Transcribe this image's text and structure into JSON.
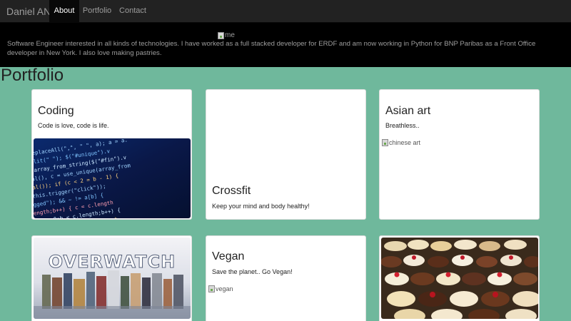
{
  "navbar": {
    "brand": "Daniel AN",
    "links": [
      {
        "label": "About",
        "active": true
      },
      {
        "label": "Portfolio",
        "active": false
      },
      {
        "label": "Contact",
        "active": false
      }
    ]
  },
  "header": {
    "avatar_alt": "me",
    "bio": "Software Engineer interested in all kinds of technologies. I have worked as a full stacked developer for ERDF and am now working in Python for BNP Paribas as a Front Office developer in New York. I also love making pastries."
  },
  "portfolio": {
    "title": "Portfolio",
    "cards": [
      {
        "title": "Coding",
        "text": "Code is love, code is life.",
        "image": "code-screenshot"
      },
      {
        "title": "Crossfit",
        "text": "Keep your mind and body healthy!",
        "image": ""
      },
      {
        "title": "Asian art",
        "text": "Breathless..",
        "image_alt": "chinese art"
      },
      {
        "title": "",
        "text": "",
        "image": "overwatch-banner",
        "image_text": "OVERWATCH"
      },
      {
        "title": "Vegan",
        "text": "Save the planet.. Go Vegan!",
        "image_alt": "vegan"
      },
      {
        "title": "",
        "text": "",
        "image": "pastries-photo"
      }
    ]
  },
  "colors": {
    "page_bg": "#6fb89c",
    "navbar_bg": "#222222",
    "header_bg": "#000000",
    "card_bg": "#ffffff"
  }
}
